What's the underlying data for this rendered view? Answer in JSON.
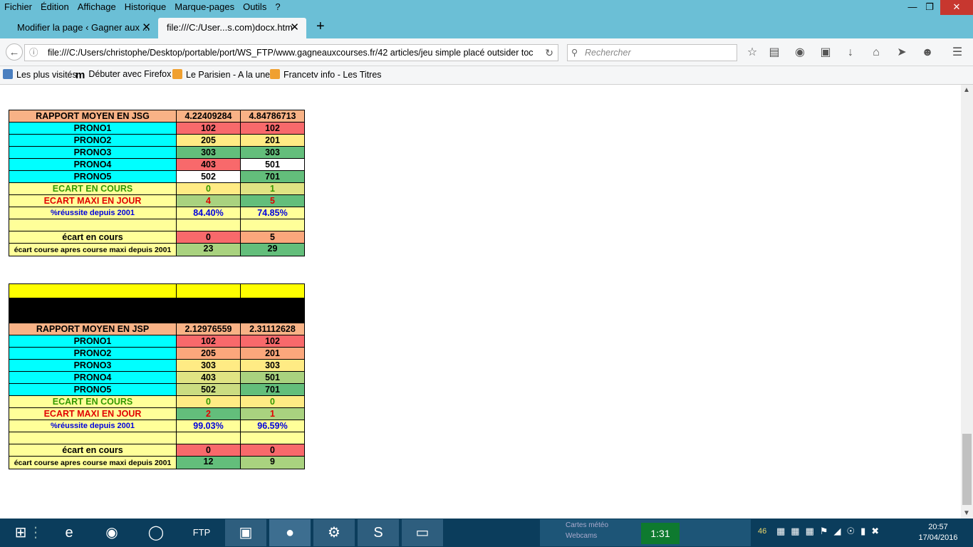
{
  "menu": [
    "Fichier",
    "Édition",
    "Affichage",
    "Historique",
    "Marque-pages",
    "Outils",
    "?"
  ],
  "tabs": [
    {
      "label": "Modifier la page ‹ Gagner aux ..."
    },
    {
      "label": "file:///C:/User...s.com)docx.htm"
    }
  ],
  "nav": {
    "url": "file:///C:/Users/christophe/Desktop/portable/port/WS_FTP/www.gagneauxcourses.fr/42 articles/jeu simple placé outsider toc",
    "search_placeholder": "Rechercher"
  },
  "bookmarks": [
    "Les plus visités",
    "Débuter avec Firefox",
    "Le Parisien - A la une",
    "Francetv info - Les Titres"
  ],
  "table1": {
    "header": {
      "label": "RAPPORT MOYEN EN JSG",
      "v1": "4.22409284",
      "v2": "4.84786713"
    },
    "pronos": [
      {
        "label": "PRONO1",
        "v1": "102",
        "v2": "102"
      },
      {
        "label": "PRONO2",
        "v1": "205",
        "v2": "201"
      },
      {
        "label": "PRONO3",
        "v1": "303",
        "v2": "303"
      },
      {
        "label": "PRONO4",
        "v1": "403",
        "v2": "501"
      },
      {
        "label": "PRONO5",
        "v1": "502",
        "v2": "701"
      }
    ],
    "ecart_cours": {
      "label": "ECART EN COURS",
      "v1": "0",
      "v2": "1"
    },
    "ecart_maxi": {
      "label": "ECART MAXI EN JOUR",
      "v1": "4",
      "v2": "5"
    },
    "reussite": {
      "label": "%réussite depuis 2001",
      "v1": "84.40%",
      "v2": "74.85%"
    },
    "ecart_en_cours": {
      "label": "écart en cours",
      "v1": "0",
      "v2": "5"
    },
    "ecart_course": {
      "label": "écart course apres course maxi depuis 2001",
      "v1": "23",
      "v2": "29"
    }
  },
  "table2": {
    "header": {
      "label": "RAPPORT MOYEN EN JSP",
      "v1": "2.12976559",
      "v2": "2.31112628"
    },
    "pronos": [
      {
        "label": "PRONO1",
        "v1": "102",
        "v2": "102"
      },
      {
        "label": "PRONO2",
        "v1": "205",
        "v2": "201"
      },
      {
        "label": "PRONO3",
        "v1": "303",
        "v2": "303"
      },
      {
        "label": "PRONO4",
        "v1": "403",
        "v2": "501"
      },
      {
        "label": "PRONO5",
        "v1": "502",
        "v2": "701"
      }
    ],
    "ecart_cours": {
      "label": "ECART EN COURS",
      "v1": "0",
      "v2": "0"
    },
    "ecart_maxi": {
      "label": "ECART MAXI EN JOUR",
      "v1": "2",
      "v2": "1"
    },
    "reussite": {
      "label": "%réussite depuis 2001",
      "v1": "99.03%",
      "v2": "96.59%"
    },
    "ecart_en_cours": {
      "label": "écart en cours",
      "v1": "0",
      "v2": "0"
    },
    "ecart_course": {
      "label": "écart course apres course maxi depuis 2001",
      "v1": "12",
      "v2": "9"
    }
  },
  "taskbar": {
    "widget_lines": [
      "Cartes météo",
      "Webcams"
    ],
    "widget_time": "1:31",
    "tray_count": "46",
    "time": "20:57",
    "date": "17/04/2016"
  }
}
